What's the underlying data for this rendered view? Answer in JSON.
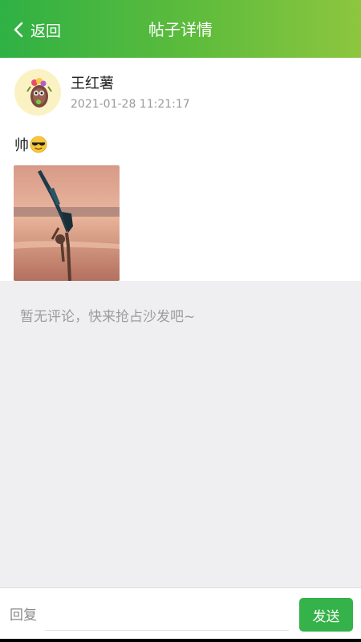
{
  "header": {
    "back_label": "返回",
    "title": "帖子详情"
  },
  "post": {
    "author": "王红薯",
    "timestamp": "2021-01-28 11:21:17",
    "text": "帅",
    "emoji": "sunglasses-emoji",
    "image": "yoga-handstand-beach-photo"
  },
  "comments": {
    "empty_text": "暂无评论，快来抢占沙发吧~"
  },
  "reply_bar": {
    "placeholder": "回复",
    "value": "",
    "send_label": "发送"
  },
  "colors": {
    "header_start": "#2fb144",
    "header_end": "#8dc63f",
    "send_button": "#35b24a",
    "page_background": "#efeef1"
  }
}
